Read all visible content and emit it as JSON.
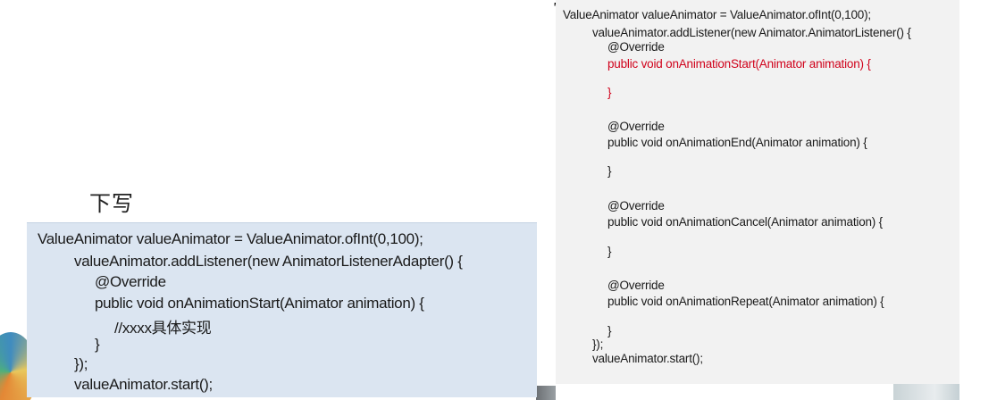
{
  "heading": "下写",
  "left_code": {
    "lines": [
      "ValueAnimator valueAnimator = ValueAnimator.ofInt(0,100);",
      "valueAnimator.addListener(new AnimatorListenerAdapter() {",
      "@Override",
      "public void onAnimationStart(Animator animation) {",
      "//xxxx具体实现",
      "}",
      "});",
      "valueAnimator.start();"
    ]
  },
  "right_code": {
    "lines": [
      "ValueAnimator valueAnimator = ValueAnimator.ofInt(0,100);",
      "valueAnimator.addListener(new Animator.AnimatorListener() {",
      "@Override",
      "public void onAnimationStart(Animator animation) {",
      "}",
      "@Override",
      "public void onAnimationEnd(Animator animation) {",
      "}",
      "@Override",
      "public void onAnimationCancel(Animator animation) {",
      "}",
      "@Override",
      "public void onAnimationRepeat(Animator animation) {",
      "}",
      "});",
      "valueAnimator.start();"
    ],
    "highlight_color": "#d0021b"
  },
  "colors": {
    "left_box_bg": "#dbe5f1",
    "right_panel_bg": "#f2f2f2",
    "text": "#1a1a1a"
  }
}
